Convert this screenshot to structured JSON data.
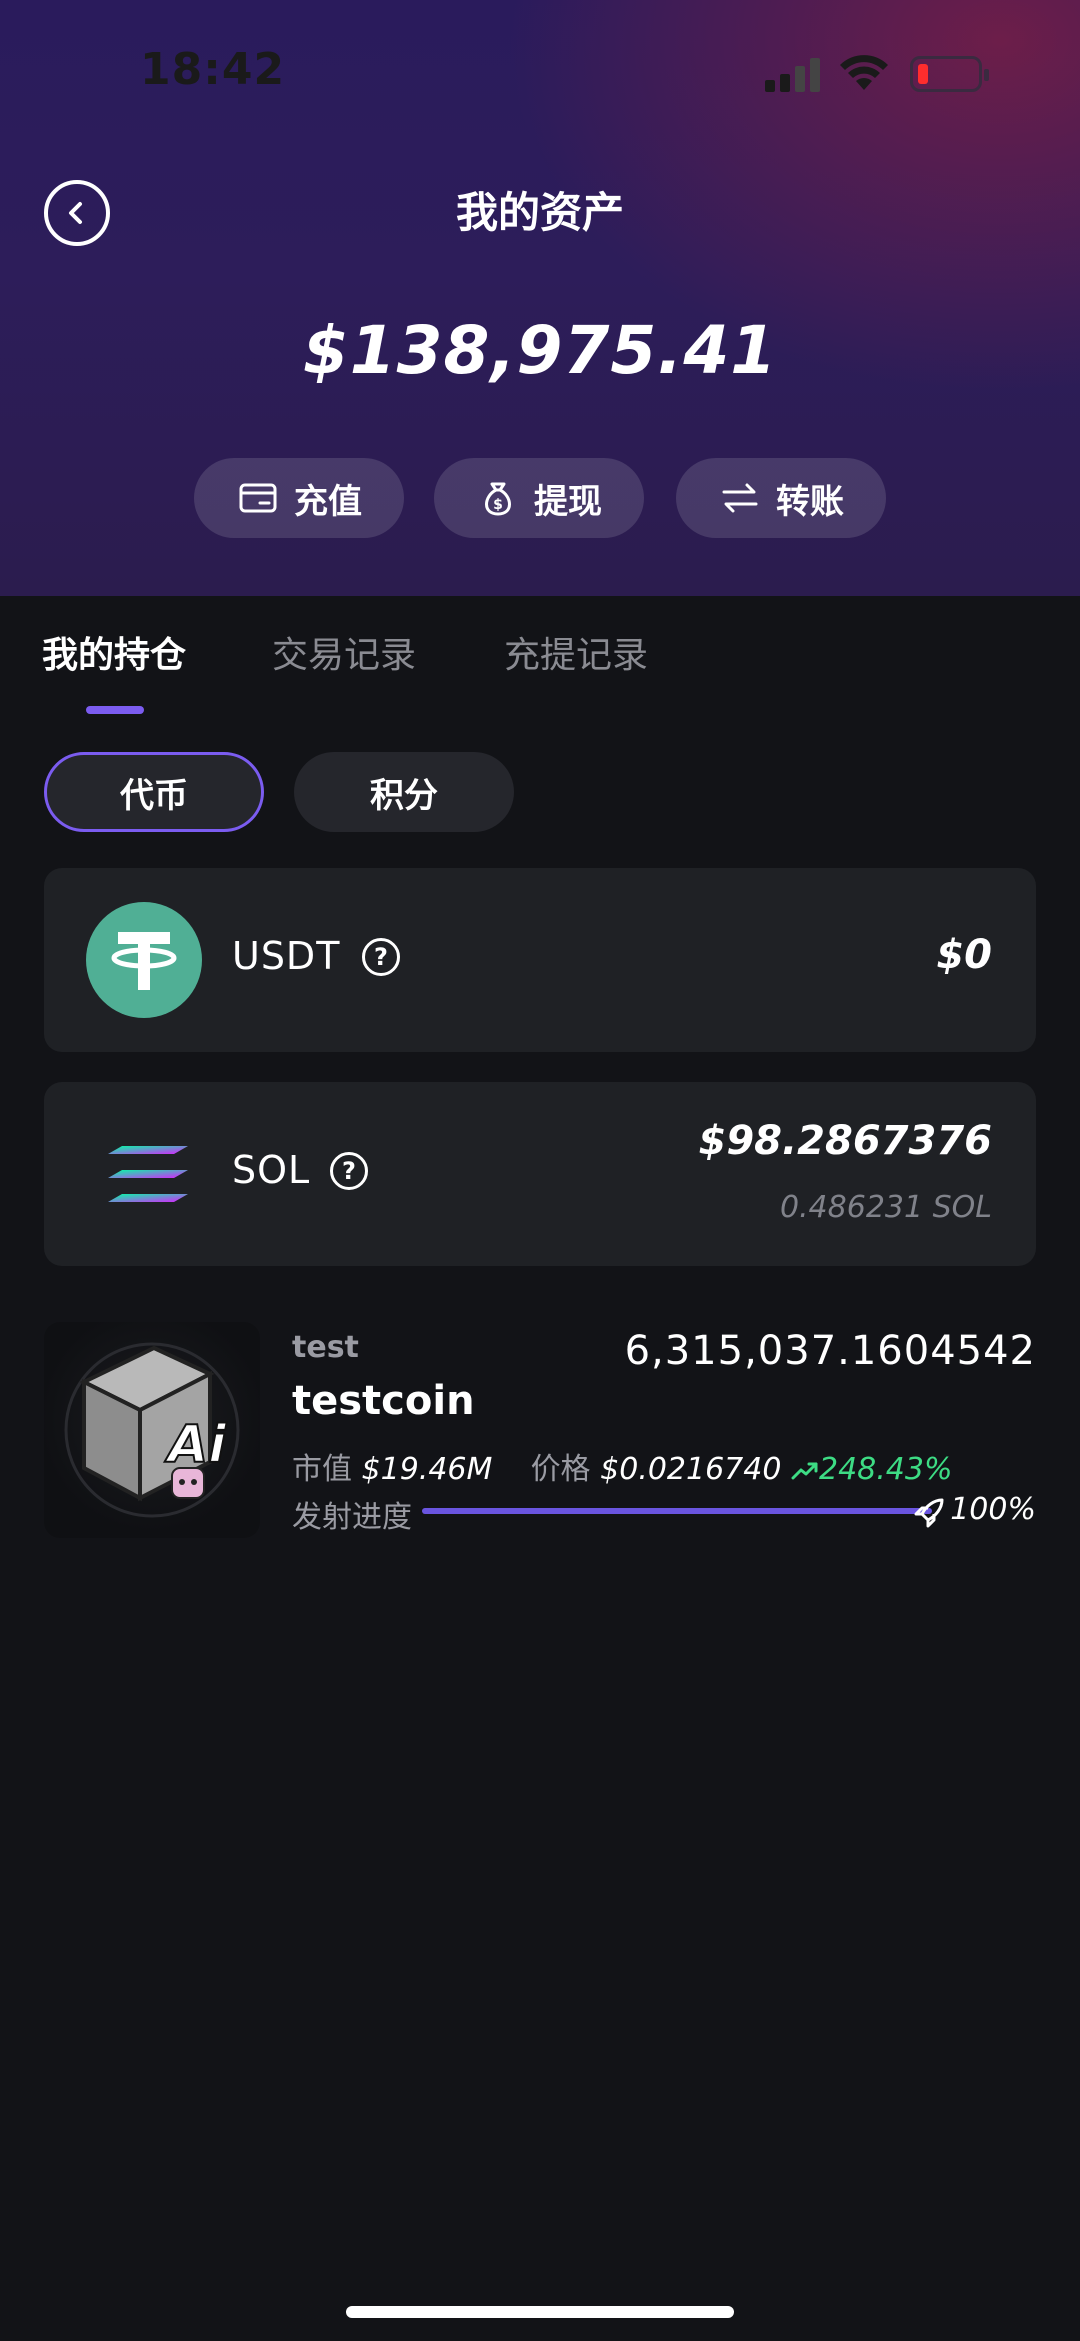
{
  "status_bar": {
    "time": "18:42"
  },
  "header": {
    "title": "我的资产",
    "balance": "$138,975.41"
  },
  "actions": [
    {
      "label": "充值",
      "icon": "card-icon"
    },
    {
      "label": "提现",
      "icon": "money-bag-icon"
    },
    {
      "label": "转账",
      "icon": "transfer-icon"
    }
  ],
  "tabs": [
    {
      "label": "我的持仓",
      "active": true
    },
    {
      "label": "交易记录",
      "active": false
    },
    {
      "label": "充提记录",
      "active": false
    }
  ],
  "filters": [
    {
      "label": "代币",
      "selected": true
    },
    {
      "label": "积分",
      "selected": false
    }
  ],
  "assets": [
    {
      "name": "USDT",
      "value": "$0"
    },
    {
      "name": "SOL",
      "value": "$98.2867376",
      "amount": "0.486231 SOL"
    }
  ],
  "token": {
    "symbol": "test",
    "name": "testcoin",
    "amount": "6,315,037.1604542",
    "market_cap_label": "市值",
    "market_cap": "$19.46M",
    "price_label": "价格",
    "price": "$0.0216740",
    "change": "248.43%",
    "progress_label": "发射进度",
    "progress_percent": 100,
    "progress_text": "100%"
  },
  "colors": {
    "accent": "#7b5cf0",
    "positive": "#3ddc84",
    "usdt": "#50af95"
  }
}
